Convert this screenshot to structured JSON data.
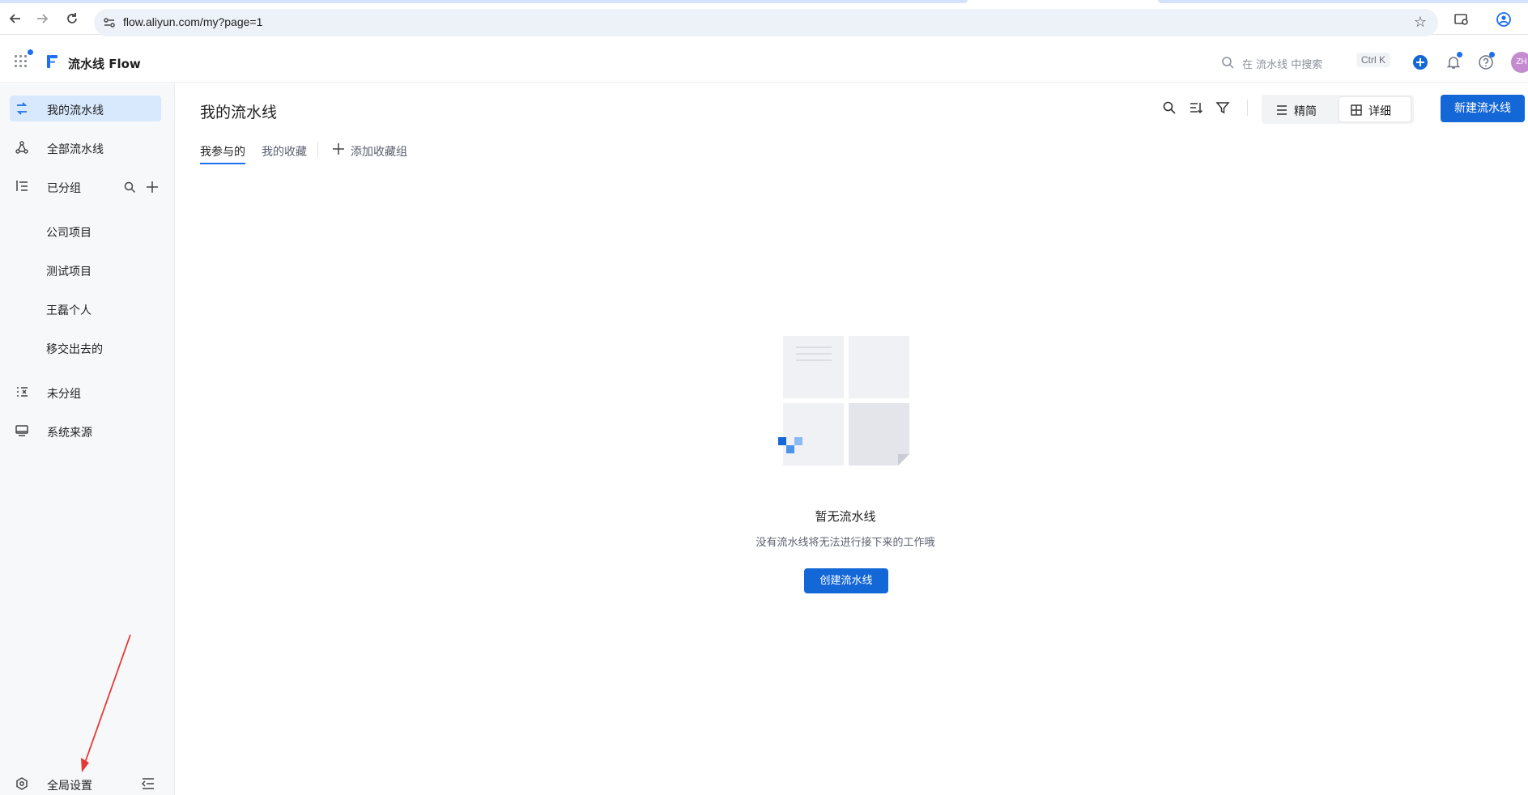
{
  "browser": {
    "url": "flow.aliyun.com/my?page=1"
  },
  "header": {
    "app_title": "流水线 Flow",
    "search_placeholder": "在 流水线 中搜索",
    "shortcut": "Ctrl K",
    "avatar_text": "ZH"
  },
  "sidebar": {
    "items": [
      {
        "label": "我的流水线",
        "icon": "pipeline-icon",
        "active": true
      },
      {
        "label": "全部流水线",
        "icon": "nodes-icon"
      },
      {
        "label": "已分组",
        "icon": "group-list-icon"
      },
      {
        "label": "未分组",
        "icon": "ungrouped-icon"
      },
      {
        "label": "系统来源",
        "icon": "monitor-icon"
      }
    ],
    "groups": [
      "公司项目",
      "测试项目",
      "王磊个人",
      "移交出去的"
    ],
    "settings_label": "全局设置"
  },
  "main": {
    "title": "我的流水线",
    "tabs": [
      "我参与的",
      "我的收藏",
      "添加收藏组"
    ],
    "view_options": [
      "精简",
      "详细"
    ],
    "new_button": "新建流水线"
  },
  "empty_state": {
    "title": "暂无流水线",
    "description": "没有流水线将无法进行接下来的工作哦",
    "button": "创建流水线"
  },
  "colors": {
    "accent": "#1467d6",
    "active_nav_bg": "#d8e8fd",
    "annotation_arrow": "#e53935"
  }
}
